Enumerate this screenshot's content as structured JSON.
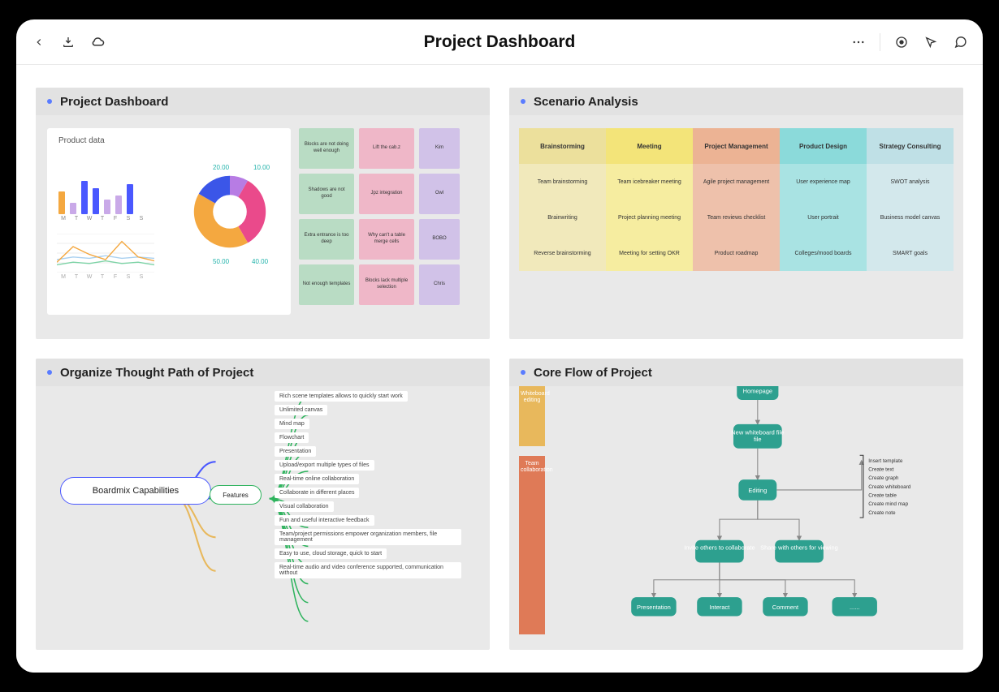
{
  "header": {
    "title": "Project Dashboard"
  },
  "panels": {
    "dashboard": {
      "title": "Project Dashboard",
      "product_label": "Product data"
    },
    "scenario": {
      "title": "Scenario Analysis"
    },
    "thought": {
      "title": "Organize Thought Path of Project"
    },
    "flow": {
      "title": "Core Flow of Project"
    }
  },
  "chart_data": [
    {
      "type": "bar",
      "categories": [
        "M",
        "T",
        "W",
        "T",
        "F",
        "S",
        "S"
      ],
      "values": [
        30,
        15,
        45,
        35,
        20,
        25,
        40
      ],
      "colors": [
        "#f4a840",
        "#c9a9e8",
        "#4a58ff",
        "#4a58ff",
        "#c9a9e8",
        "#c9a9e8",
        "#4a58ff"
      ],
      "ylim": [
        0,
        50
      ]
    },
    {
      "type": "line",
      "categories": [
        "M",
        "T",
        "W",
        "T",
        "F",
        "S",
        "S"
      ],
      "series": [
        {
          "name": "a",
          "values": [
            10,
            12,
            11,
            13,
            11,
            12,
            11
          ],
          "color": "#a9d0f0"
        },
        {
          "name": "b",
          "values": [
            8,
            20,
            14,
            10,
            24,
            12,
            9
          ],
          "color": "#f4a840"
        },
        {
          "name": "c",
          "values": [
            6,
            8,
            7,
            9,
            7,
            8,
            6
          ],
          "color": "#7dd3a6"
        }
      ],
      "ylim": [
        0,
        30
      ]
    },
    {
      "type": "pie",
      "slices": [
        {
          "label": "10.00",
          "value": 10,
          "color": "#b77ce4"
        },
        {
          "label": "40.00",
          "value": 40,
          "color": "#ea4a8b"
        },
        {
          "label": "50.00",
          "value": 50,
          "color": "#f4a840"
        },
        {
          "label": "20.00",
          "value": 20,
          "color": "#3b56e8"
        }
      ],
      "donut": true
    }
  ],
  "sticky_notes": [
    [
      {
        "text": "Blocks are not doing well enough",
        "color": "#b9dcc4"
      },
      {
        "text": "Lift the cab.z",
        "color": "#efb7c8"
      },
      {
        "text": "Kim",
        "color": "#d1c2e8"
      }
    ],
    [
      {
        "text": "Shadows are not good",
        "color": "#b9dcc4"
      },
      {
        "text": "Jpz integration",
        "color": "#efb7c8"
      },
      {
        "text": "Owl",
        "color": "#d1c2e8"
      }
    ],
    [
      {
        "text": "Extra entrance is too deep",
        "color": "#b9dcc4"
      },
      {
        "text": "Why can't a table merge cells",
        "color": "#efb7c8"
      },
      {
        "text": "BOBO",
        "color": "#d1c2e8"
      }
    ],
    [
      {
        "text": "Not enough templates",
        "color": "#b9dcc4"
      },
      {
        "text": "Blocks lack multiple selection",
        "color": "#efb7c8"
      },
      {
        "text": "Chris",
        "color": "#d1c2e8"
      }
    ]
  ],
  "scenario_table": {
    "headers": [
      "Brainstorming",
      "Meeting",
      "Project Management",
      "Product Design",
      "Strategy Consulting"
    ],
    "rows": [
      [
        "Team brainstorming",
        "Team icebreaker meeting",
        "Agile project management",
        "User experience map",
        "SWOT analysis"
      ],
      [
        "Brainwriting",
        "Project planning meeting",
        "Team reviews checklist",
        "User portrait",
        "Business model canvas"
      ],
      [
        "Reverse brainstorming",
        "Meeting for setting OKR",
        "Product roadmap",
        "Colleges/mood boards",
        "SMART goals"
      ]
    ]
  },
  "mindmap": {
    "root": "Boardmix Capabilities",
    "feature_node": "Features",
    "items": [
      "Rich scene templates allows to quickly start work",
      "Unlimited canvas",
      "Mind map",
      "Flowchart",
      "Presentation",
      "Upload/export multiple types of files",
      "Real-time online collaboration",
      "Collaborate in different places",
      "Visual collaboration",
      "Fun and useful interactive feedback",
      "Team/project permissions empower organization members, file management",
      "Easy to use, cloud storage, quick to start",
      "Real-time audio and video conference supported, communication without"
    ]
  },
  "flow": {
    "side_labels": [
      "Whiteboard editing",
      "Team collaboration"
    ],
    "nodes": {
      "top": "Homepage",
      "new": "New whiteboard file",
      "edit": "Editing",
      "invite": "Invite others to collaborate",
      "share": "Share with others for viewing",
      "leaf1": "Presentation",
      "leaf2": "Interact",
      "leaf3": "Comment",
      "leaf4": "......"
    },
    "notes": [
      "Insert template",
      "Create text",
      "Create graph",
      "Create whiteboard",
      "Create table",
      "Create mind map",
      "Create note"
    ]
  }
}
